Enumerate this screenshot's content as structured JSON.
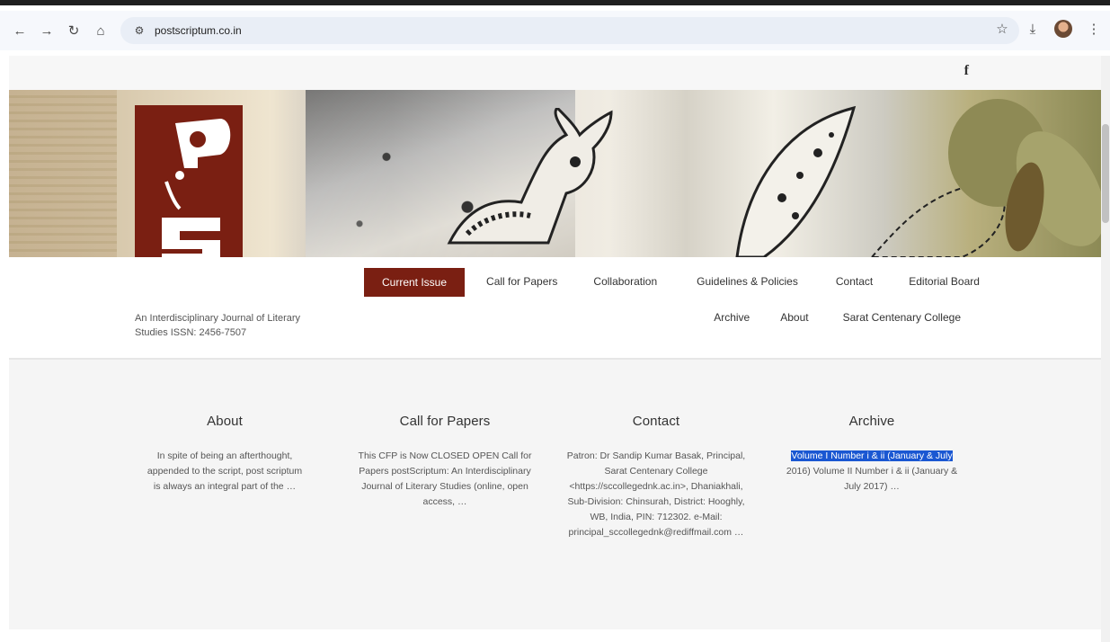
{
  "browser": {
    "url": "postscriptum.co.in"
  },
  "social": {
    "facebook_label": "f"
  },
  "logo": {
    "wordmark": "postscriptum"
  },
  "site": {
    "tagline": "An Interdisciplinary Journal of Literary Studies ISSN: 2456-7507"
  },
  "menu": {
    "row1": [
      "Current Issue",
      "Call for Papers",
      "Collaboration",
      "Guidelines & Policies",
      "Contact",
      "Editorial Board"
    ],
    "row2": [
      "Archive",
      "About",
      "Sarat Centenary College"
    ],
    "active_color": "#7a1f12"
  },
  "widgets": {
    "about": {
      "title": "About",
      "text": "In spite of being an afterthought, appended to the script, post scriptum is always an integral part of the …"
    },
    "cfp": {
      "title": "Call for Papers",
      "text": "This CFP is Now CLOSED OPEN Call for Papers  postScriptum:  An  Interdisciplinary Journal of  Literary  Studies (online, open access, …"
    },
    "contact": {
      "title": "Contact",
      "text": "Patron: Dr Sandip Kumar Basak, Principal, Sarat Centenary College <https://sccollegednk.ac.in>, Dhaniakhali, Sub-Division: Chinsurah, District: Hooghly, WB, India, PIN: 712302. e-Mail: principal_sccollegednk@rediffmail.com …"
    },
    "archive": {
      "title": "Archive",
      "highlighted": "Volume I Number i & ii (January & July",
      "text": " 2016) Volume II Number i & ii (January & July 2017) …"
    }
  }
}
